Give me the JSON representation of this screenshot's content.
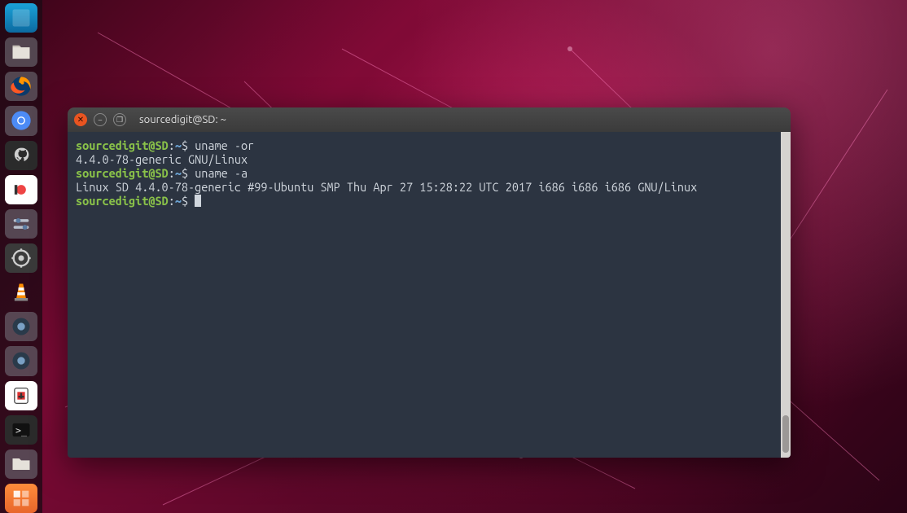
{
  "launcher": {
    "items": [
      {
        "name": "ubuntu-dash",
        "tooltip": "Dash"
      },
      {
        "name": "files",
        "tooltip": "Files"
      },
      {
        "name": "firefox",
        "tooltip": "Firefox Web Browser"
      },
      {
        "name": "chromium",
        "tooltip": "Chromium Web Browser"
      },
      {
        "name": "github-desktop",
        "tooltip": "GitHub Desktop"
      },
      {
        "name": "software-center",
        "tooltip": "Ubuntu Software"
      },
      {
        "name": "gnome-tweaks",
        "tooltip": "Tweaks"
      },
      {
        "name": "settings",
        "tooltip": "Settings"
      },
      {
        "name": "vlc",
        "tooltip": "VLC media player"
      },
      {
        "name": "chat-1",
        "tooltip": "Messaging"
      },
      {
        "name": "chat-2",
        "tooltip": "Messaging"
      },
      {
        "name": "transmission",
        "tooltip": "Transmission"
      },
      {
        "name": "terminal",
        "tooltip": "Terminal"
      },
      {
        "name": "folder",
        "tooltip": "Folder"
      },
      {
        "name": "workspace",
        "tooltip": "Workspace Switcher"
      }
    ]
  },
  "terminal": {
    "title": "sourcedigit@SD: ~",
    "window_controls": {
      "close": "✕",
      "min": "–",
      "max": "❐"
    },
    "prompt": {
      "user_host": "sourcedigit@SD",
      "separator": ":",
      "path": "~",
      "symbol": "$"
    },
    "lines": [
      {
        "type": "cmd",
        "command": "uname -or"
      },
      {
        "type": "out",
        "text": "4.4.0-78-generic GNU/Linux"
      },
      {
        "type": "cmd",
        "command": "uname -a"
      },
      {
        "type": "out",
        "text": "Linux SD 4.4.0-78-generic #99-Ubuntu SMP Thu Apr 27 15:28:22 UTC 2017 i686 i686 i686 GNU/Linux"
      },
      {
        "type": "cmd",
        "command": "",
        "cursor": true
      }
    ],
    "colors": {
      "user_host": "#89c149",
      "path": "#6aa0cf",
      "background": "#2c3441"
    }
  }
}
